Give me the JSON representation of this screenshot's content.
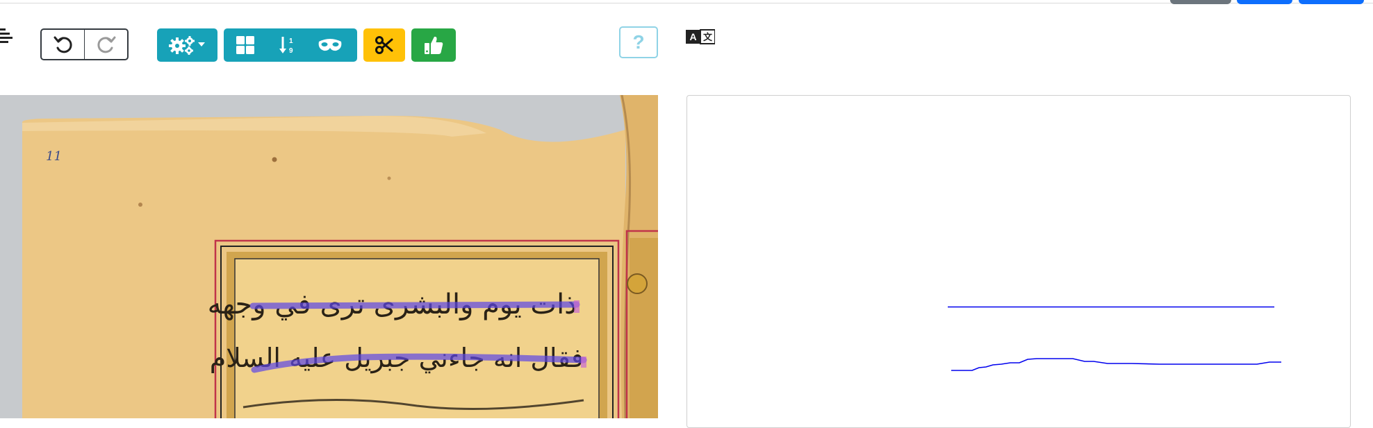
{
  "toolbar": {
    "undo_icon": "undo-icon",
    "redo_icon": "redo-icon",
    "settings_icon": "cogs-dropdown-icon",
    "view_icons": [
      "layout-grid-icon",
      "sort-numeric-icon",
      "mask-icon"
    ],
    "cut_icon": "scissors-icon",
    "validate_icon": "thumbs-up-icon",
    "help_label": "?",
    "translate_icon": "translate-icon"
  },
  "image": {
    "page_number": "11",
    "lines": [
      "ذات يوم والبشرى ترى في وجهه",
      "فقال انه جاءني جبريل عليه السلام"
    ]
  },
  "colors": {
    "teal": "#17a2b8",
    "yellow": "#ffc107",
    "green": "#28a745",
    "baseline": "#0000ee"
  }
}
